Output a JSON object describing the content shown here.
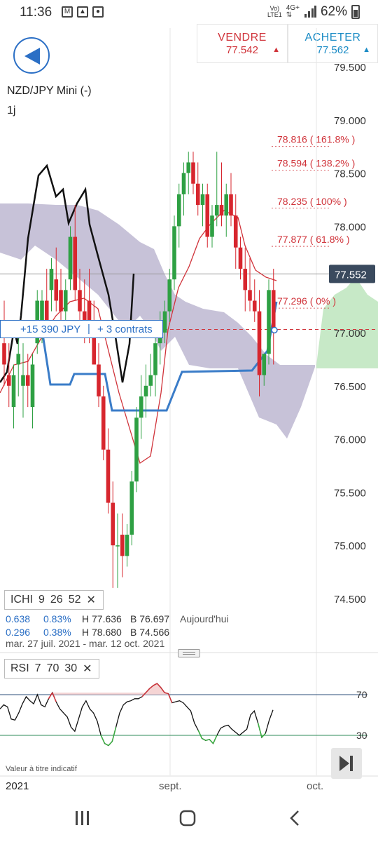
{
  "status": {
    "time": "11:36",
    "network_top": "Vo)",
    "network_bottom": "LTE1",
    "data_top": "4G+",
    "battery": "62%",
    "icons": [
      "gmail-icon",
      "gallery-icon",
      "alarm-icon",
      "wifi-calling-icon",
      "signal-icon",
      "battery-icon"
    ]
  },
  "trade": {
    "sell_label": "VENDRE",
    "sell_price": "77.542",
    "buy_label": "ACHETER",
    "buy_price": "77.562",
    "sell_color": "#d0333a",
    "buy_color": "#1a8bc5"
  },
  "instrument": {
    "symbol": "NZD/JPY Mini (-)",
    "period": "1j"
  },
  "price_axis": {
    "labels": [
      "79.500",
      "79.000",
      "78.500",
      "78.000",
      "77.000",
      "76.500",
      "76.000",
      "75.500",
      "75.000",
      "74.500"
    ],
    "current_price": "77.552",
    "current_price_bg": "#3a4a5e"
  },
  "fibonacci": {
    "levels": [
      {
        "price": 78.816,
        "label": "78.816 ( 161.8% )"
      },
      {
        "price": 78.594,
        "label": "78.594 ( 138.2% )"
      },
      {
        "price": 78.235,
        "label": "78.235 ( 100% )"
      },
      {
        "price": 77.877,
        "label": "77.877 ( 61.8% )"
      },
      {
        "price": 77.296,
        "label": "77.296 ( 0% )"
      }
    ],
    "color": "#d0333a"
  },
  "position": {
    "pnl": "+15 390 JPY",
    "contracts": "+ 3 contrats",
    "entry_price": 77.03,
    "color": "#2b6fc5"
  },
  "ichimoku": {
    "name": "ICHI",
    "params": [
      "9",
      "26",
      "52"
    ],
    "row1": {
      "a": "0.638",
      "b": "0.83%",
      "h": "H 77.636",
      "bv": "B 76.697",
      "note": "Aujourd'hui"
    },
    "row2": {
      "a": "0.296",
      "b": "0.38%",
      "h": "H 78.680",
      "bv": "B 74.566"
    },
    "date_range": "mar. 27 juil. 2021 - mar. 12 oct. 2021",
    "cloud_color": "#b4aecb",
    "future_cloud_color": "#b9e3b9",
    "kijun_color": "#3a7cc8",
    "lagging_color": "#111111",
    "tenkan_color": "#d0333a"
  },
  "rsi": {
    "name": "RSI",
    "params": [
      "7",
      "70",
      "30"
    ],
    "upper_label": "70",
    "lower_label": "30",
    "upper": 70,
    "lower": 30,
    "values": [
      56,
      60,
      58,
      46,
      45,
      52,
      61,
      68,
      64,
      61,
      70,
      60,
      58,
      66,
      72,
      63,
      56,
      52,
      48,
      38,
      34,
      46,
      58,
      64,
      56,
      52,
      44,
      30,
      22,
      20,
      24,
      38,
      52,
      60,
      63,
      64,
      66,
      66,
      68,
      72,
      76,
      79,
      81,
      77,
      72,
      71,
      62,
      63,
      64,
      62,
      58,
      54,
      42,
      35,
      27,
      25,
      26,
      22,
      30,
      37,
      39,
      40,
      36,
      33,
      30,
      33,
      36,
      50,
      54,
      42,
      28,
      32,
      45,
      55
    ]
  },
  "xaxis": {
    "labels": [
      "2021",
      "sept.",
      "oct."
    ]
  },
  "footer": {
    "disclaimer": "Valeur à titre indicatif"
  },
  "candles": [
    [
      76.9,
      77.3,
      76.5,
      76.7
    ],
    [
      76.6,
      76.9,
      76.3,
      76.5
    ],
    [
      76.3,
      76.7,
      76.1,
      76.6
    ],
    [
      76.7,
      77.0,
      76.4,
      76.8
    ],
    [
      76.5,
      76.9,
      76.2,
      76.6
    ],
    [
      76.6,
      76.8,
      76.3,
      76.5
    ],
    [
      76.3,
      76.8,
      76.1,
      76.7
    ],
    [
      76.9,
      77.4,
      76.8,
      77.3
    ],
    [
      77.0,
      77.4,
      76.9,
      77.3
    ],
    [
      77.3,
      77.6,
      77.0,
      77.1
    ],
    [
      77.4,
      77.7,
      77.2,
      77.6
    ],
    [
      77.5,
      77.8,
      77.2,
      77.3
    ],
    [
      77.4,
      77.6,
      77.1,
      77.2
    ],
    [
      77.2,
      77.5,
      77.0,
      77.4
    ],
    [
      77.5,
      78.0,
      77.4,
      77.9
    ],
    [
      77.9,
      78.2,
      77.3,
      77.4
    ],
    [
      77.4,
      77.6,
      77.0,
      77.2
    ],
    [
      77.2,
      77.5,
      76.9,
      77.1
    ],
    [
      77.3,
      77.6,
      76.9,
      77.0
    ],
    [
      77.0,
      77.3,
      76.7,
      76.7
    ],
    [
      76.7,
      76.9,
      76.3,
      76.4
    ],
    [
      76.4,
      76.5,
      75.8,
      75.9
    ],
    [
      75.9,
      76.1,
      75.3,
      75.4
    ],
    [
      75.4,
      75.6,
      74.6,
      75.0
    ],
    [
      75.0,
      75.3,
      74.6,
      75.0
    ],
    [
      75.1,
      75.3,
      74.7,
      74.9
    ],
    [
      74.9,
      75.2,
      74.8,
      75.1
    ],
    [
      75.1,
      75.7,
      75.0,
      75.6
    ],
    [
      75.6,
      76.3,
      75.5,
      76.2
    ],
    [
      76.2,
      76.6,
      76.0,
      76.4
    ],
    [
      76.4,
      76.7,
      76.2,
      76.5
    ],
    [
      76.5,
      76.8,
      76.4,
      76.6
    ],
    [
      76.6,
      77.0,
      76.4,
      76.9
    ],
    [
      76.9,
      77.2,
      76.7,
      77.0
    ],
    [
      77.0,
      77.3,
      76.9,
      77.2
    ],
    [
      77.2,
      77.6,
      77.1,
      77.5
    ],
    [
      77.5,
      78.1,
      77.4,
      78.0
    ],
    [
      78.0,
      78.4,
      77.8,
      78.3
    ],
    [
      78.3,
      78.6,
      78.1,
      78.5
    ],
    [
      78.5,
      78.7,
      78.3,
      78.6
    ],
    [
      78.6,
      78.7,
      78.3,
      78.4
    ],
    [
      78.4,
      78.6,
      78.1,
      78.2
    ],
    [
      78.2,
      78.4,
      78.0,
      78.3
    ],
    [
      78.3,
      78.4,
      77.8,
      77.9
    ],
    [
      77.9,
      78.2,
      77.8,
      78.1
    ],
    [
      78.1,
      78.7,
      78.0,
      78.2
    ],
    [
      78.2,
      78.6,
      78.0,
      78.1
    ],
    [
      78.1,
      78.4,
      77.9,
      78.3
    ],
    [
      78.3,
      78.5,
      78.0,
      78.1
    ],
    [
      78.1,
      78.3,
      77.6,
      77.8
    ],
    [
      77.8,
      77.9,
      77.5,
      77.6
    ],
    [
      77.6,
      77.8,
      77.2,
      77.4
    ],
    [
      77.4,
      77.7,
      77.2,
      77.3
    ],
    [
      77.3,
      77.5,
      77.1,
      77.2
    ],
    [
      77.2,
      77.4,
      76.4,
      76.6
    ],
    [
      76.6,
      76.8,
      76.5,
      76.8
    ],
    [
      76.8,
      77.5,
      76.7,
      77.4
    ],
    [
      77.4,
      77.6,
      76.7,
      77.0
    ]
  ]
}
